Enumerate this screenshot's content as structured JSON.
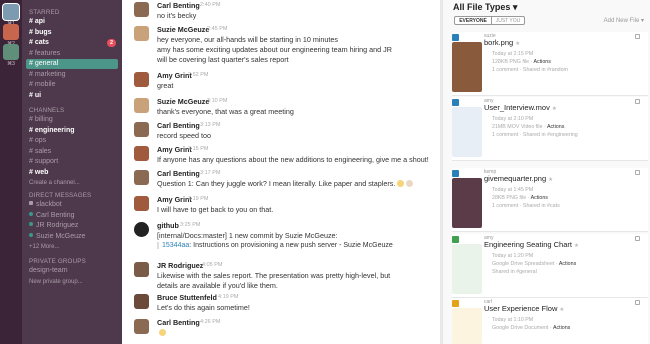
{
  "teams": [
    {
      "label": "⌘1"
    },
    {
      "label": "⌘2"
    },
    {
      "label": "⌘3"
    }
  ],
  "sidebar": {
    "starred_heading": "STARRED",
    "starred": [
      {
        "label": "# api",
        "bold": true
      },
      {
        "label": "# bugs",
        "bold": true
      },
      {
        "label": "# cats",
        "bold": true,
        "badge": "2"
      },
      {
        "label": "# features"
      },
      {
        "label": "# general",
        "active": true
      },
      {
        "label": "# marketing"
      },
      {
        "label": "# mobile"
      },
      {
        "label": "# ui",
        "bold": true
      }
    ],
    "channels_heading": "CHANNELS",
    "channels": [
      {
        "label": "# billing"
      },
      {
        "label": "# engineering",
        "bold": true
      },
      {
        "label": "# ops"
      },
      {
        "label": "# sales"
      },
      {
        "label": "# support"
      },
      {
        "label": "# web",
        "bold": true
      }
    ],
    "create_channel": "Create a channel...",
    "dm_heading": "DIRECT MESSAGES",
    "dms": [
      {
        "label": "slackbot",
        "status": "heart"
      },
      {
        "label": "Carl Benting",
        "status": "on"
      },
      {
        "label": "JR Rodriguez",
        "status": "on"
      },
      {
        "label": "Suzie McGeuze",
        "status": "on"
      }
    ],
    "dm_more": "+12 More...",
    "groups_heading": "PRIVATE GROUPS",
    "groups": [
      {
        "label": "design-team"
      }
    ],
    "new_group": "New private group..."
  },
  "messages": [
    {
      "author": "Carl Benting",
      "time": "2:40 PM",
      "avatar_color": "#8a6a52",
      "lines": [
        "no it's becky"
      ]
    },
    {
      "author": "Suzie McGeuze",
      "time": "2:45 PM",
      "avatar_color": "#c9a27a",
      "lines": [
        "hey everyone, our all-hands will be starting in 10 minutes",
        "amy has some exciting updates about our engineering team hiring and JR",
        "will be covering last quarter's sales report"
      ]
    },
    {
      "author": "Amy Grint",
      "time": "2:52 PM",
      "avatar_color": "#a05a3e",
      "lines": [
        "great"
      ]
    },
    {
      "author": "Suzie McGeuze",
      "time": "3:10 PM",
      "avatar_color": "#c9a27a",
      "lines": [
        "thank's everyone, that was a great meeting"
      ]
    },
    {
      "author": "Carl Benting",
      "time": "3:13 PM",
      "avatar_color": "#8a6a52",
      "lines": [
        "record speed too"
      ]
    },
    {
      "author": "Amy Grint",
      "time": "3:15 PM",
      "avatar_color": "#a05a3e",
      "lines": [
        "If anyone has any questions about the new additions to engineering, give me a shout!"
      ]
    },
    {
      "author": "Carl Benting",
      "time": "3:17 PM",
      "avatar_color": "#8a6a52",
      "lines": [
        "Question 1: Can they juggle work? I mean literally. Like paper and staplers."
      ]
    },
    {
      "author": "Amy Grint",
      "time": "3:19 PM",
      "avatar_color": "#a05a3e",
      "lines": [
        "I will have to get back to you on that."
      ]
    },
    {
      "author": "github",
      "time": "3:25 PM",
      "avatar_color": "#222222",
      "lines": [
        "[internal/Docs:master] 1 new commit by Suzie McGeuze:"
      ],
      "snippet_ref": "15344aa",
      "snippet_text": ": Instructions on provisioning a new push server - Suzie McGeuze"
    },
    {
      "author": "JR Rodriguez",
      "time": "4:05 PM",
      "avatar_color": "#7a5b48",
      "lines": [
        "Likewise with the sales report. The presentation was pretty high-level, but",
        "details are available if you'd like them."
      ]
    },
    {
      "author": "Bruce Stuttenfeld",
      "time": "4:19 PM",
      "avatar_color": "#6b4a3a",
      "lines": [
        "Let's do this again sometime!"
      ]
    },
    {
      "author": "Carl Benting",
      "time": "4:26 PM",
      "avatar_color": "#8a6a52",
      "lines": [
        ""
      ]
    }
  ],
  "panel": {
    "title": "All File Types",
    "title_caret": "▾",
    "add_file": "Add New File",
    "add_file_caret": "▾",
    "filter_everyone": "EVERYONE",
    "filter_you": "JUST YOU",
    "files": [
      {
        "user": "suzie",
        "name": "bork.png",
        "type_color": "#2a80b9",
        "meta1": "Today at 2:15 PM",
        "meta2": "128KB PNG file · ",
        "action": "Actions",
        "meta3": "1 comment · Shared in #random",
        "thumb": "#8a5a3c"
      },
      {
        "user": "amy",
        "name": "User_Interview.mov",
        "type_color": "#2a80b9",
        "meta1": "Today at 2:10 PM",
        "meta2": "21MB MOV Video file · ",
        "action": "Actions",
        "meta3": "1 comment · Shared in #engineering",
        "thumb": "#e8eef5"
      },
      {
        "user": "kemp",
        "name": "givemequarter.png",
        "type_color": "#2a80b9",
        "meta1": "Today at 1:45 PM",
        "meta2": "28KB PNG file · ",
        "action": "Actions",
        "meta3": "1 comment · Shared in #cats",
        "thumb": "#5c3b49"
      },
      {
        "user": "amy",
        "name": "Engineering Seating Chart",
        "type_color": "#3fa14f",
        "meta1": "Today at 1:20 PM",
        "meta2": "Google Drive Spreadsheet · ",
        "action": "Actions",
        "meta3": "Shared in #general",
        "thumb": "#eaf3ea"
      },
      {
        "user": "carl",
        "name": "User Experience Flow",
        "type_color": "#e3a21a",
        "meta1": "Today at 1:10 PM",
        "meta2": "Google Drive Document · ",
        "action": "Actions",
        "meta3": "",
        "thumb": "#fdf4e0"
      }
    ]
  }
}
